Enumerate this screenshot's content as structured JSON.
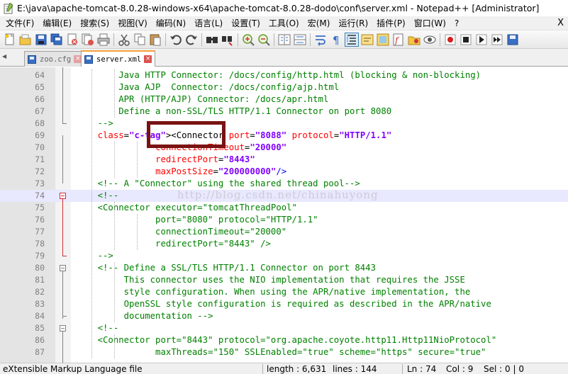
{
  "window": {
    "title": "E:\\java\\apache-tomcat-8.0.28-windows-x64\\apache-tomcat-8.0.28-dodo\\conf\\server.xml - Notepad++ [Administrator]"
  },
  "menu": {
    "items": [
      "文件(F)",
      "编辑(E)",
      "搜索(S)",
      "视图(V)",
      "编码(N)",
      "语言(L)",
      "设置(T)",
      "工具(O)",
      "宏(M)",
      "运行(R)",
      "插件(P)",
      "窗口(W)",
      "?"
    ],
    "close": "X"
  },
  "tabs": [
    {
      "label": "zoo.cfg",
      "active": false
    },
    {
      "label": "server.xml",
      "active": true
    }
  ],
  "editor": {
    "current_line": 74,
    "watermark": "http://blog.csdn.net/chinahuyong",
    "lines": [
      {
        "n": "64",
        "t": "        Java HTTP Connector: /docs/config/http.html (blocking & non-blocking)"
      },
      {
        "n": "65",
        "t": "        Java AJP  Connector: /docs/config/ajp.html"
      },
      {
        "n": "66",
        "t": "        APR (HTTP/AJP) Connector: /docs/apr.html"
      },
      {
        "n": "67",
        "t": "        Define a non-SSL/TLS HTTP/1.1 Connector on port 8080"
      },
      {
        "n": "68",
        "t": "    -->"
      },
      {
        "n": "69",
        "t": "    <Connector port=\"8088\" protocol=\"HTTP/1.1\""
      },
      {
        "n": "70",
        "t": "               connectionTimeout=\"20000\""
      },
      {
        "n": "71",
        "t": "               redirectPort=\"8443\""
      },
      {
        "n": "72",
        "t": "               maxPostSize=\"200000000\"/>"
      },
      {
        "n": "73",
        "t": "    <!-- A \"Connector\" using the shared thread pool-->"
      },
      {
        "n": "74",
        "t": "    <!--"
      },
      {
        "n": "75",
        "t": "    <Connector executor=\"tomcatThreadPool\""
      },
      {
        "n": "76",
        "t": "               port=\"8080\" protocol=\"HTTP/1.1\""
      },
      {
        "n": "77",
        "t": "               connectionTimeout=\"20000\""
      },
      {
        "n": "78",
        "t": "               redirectPort=\"8443\" />"
      },
      {
        "n": "79",
        "t": "    -->"
      },
      {
        "n": "80",
        "t": "    <!-- Define a SSL/TLS HTTP/1.1 Connector on port 8443"
      },
      {
        "n": "81",
        "t": "         This connector uses the NIO implementation that requires the JSSE"
      },
      {
        "n": "82",
        "t": "         style configuration. When using the APR/native implementation, the"
      },
      {
        "n": "83",
        "t": "         OpenSSL style configuration is required as described in the APR/native"
      },
      {
        "n": "84",
        "t": "         documentation -->"
      },
      {
        "n": "85",
        "t": "    <!--"
      },
      {
        "n": "86",
        "t": "    <Connector port=\"8443\" protocol=\"org.apache.coyote.http11.Http11NioProtocol\""
      },
      {
        "n": "87",
        "t": "               maxThreads=\"150\" SSLEnabled=\"true\" scheme=\"https\" secure=\"true\""
      }
    ]
  },
  "status": {
    "filetype": "eXtensible Markup Language file",
    "length": "length : 6,631",
    "lines": "lines : 144",
    "ln": "Ln : 74",
    "col": "Col : 9",
    "sel": "Sel : 0 | 0"
  },
  "icons": [
    "new-file-icon",
    "open-file-icon",
    "save-icon",
    "save-all-icon",
    "close-icon",
    "close-all-icon",
    "print-icon",
    "cut-icon",
    "copy-icon",
    "paste-icon",
    "undo-icon",
    "redo-icon",
    "find-icon",
    "replace-icon",
    "zoom-in-icon",
    "zoom-out-icon",
    "sync-v-icon",
    "sync-h-icon",
    "word-wrap-icon",
    "all-chars-icon",
    "indent-guide-icon",
    "lang-icon",
    "doc-map-icon",
    "function-list-icon",
    "folder-workspace-icon",
    "monitor-icon",
    "record-icon",
    "stop-icon",
    "play-icon",
    "play-multi-icon",
    "save-macro-icon"
  ]
}
